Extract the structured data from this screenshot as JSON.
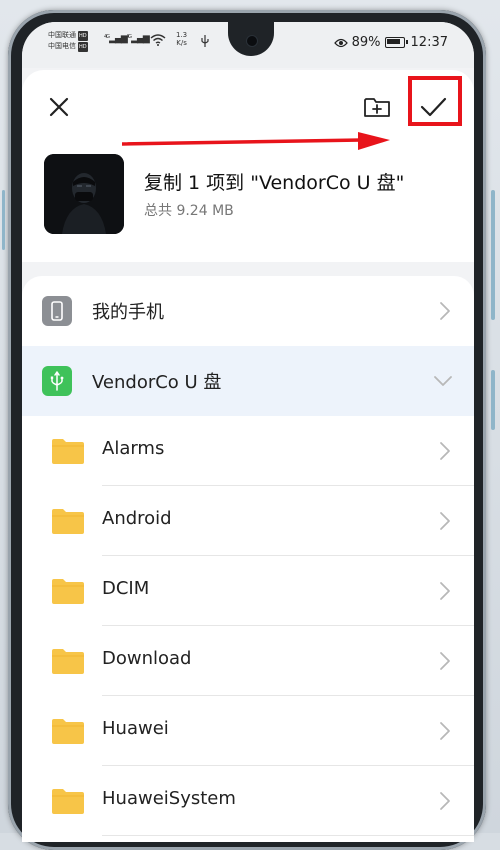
{
  "statusbar": {
    "carrier1": "中国联通",
    "carrier2": "中国电信",
    "hd": "HD",
    "sig1": "4G",
    "sig2": "4G",
    "speed_value": "1.3",
    "speed_unit": "K/s",
    "battery": "89%",
    "time": "12:37"
  },
  "header": {
    "title": "复制 1 项到 \"VendorCo U 盘\"",
    "subtitle": "总共 9.24 MB"
  },
  "locations": [
    {
      "label": "我的手机",
      "icon": "phone-icon"
    },
    {
      "label": "VendorCo U 盘",
      "icon": "usb-icon",
      "expanded": true
    }
  ],
  "folders": [
    {
      "label": "Alarms"
    },
    {
      "label": "Android"
    },
    {
      "label": "DCIM"
    },
    {
      "label": "Download"
    },
    {
      "label": "Huawei"
    },
    {
      "label": "HuaweiSystem"
    }
  ],
  "colors": {
    "accent_red": "#e8141b",
    "usb_green": "#3fc25a",
    "folder_yellow": "#f7c548",
    "selected_bg": "#edf3fb"
  }
}
